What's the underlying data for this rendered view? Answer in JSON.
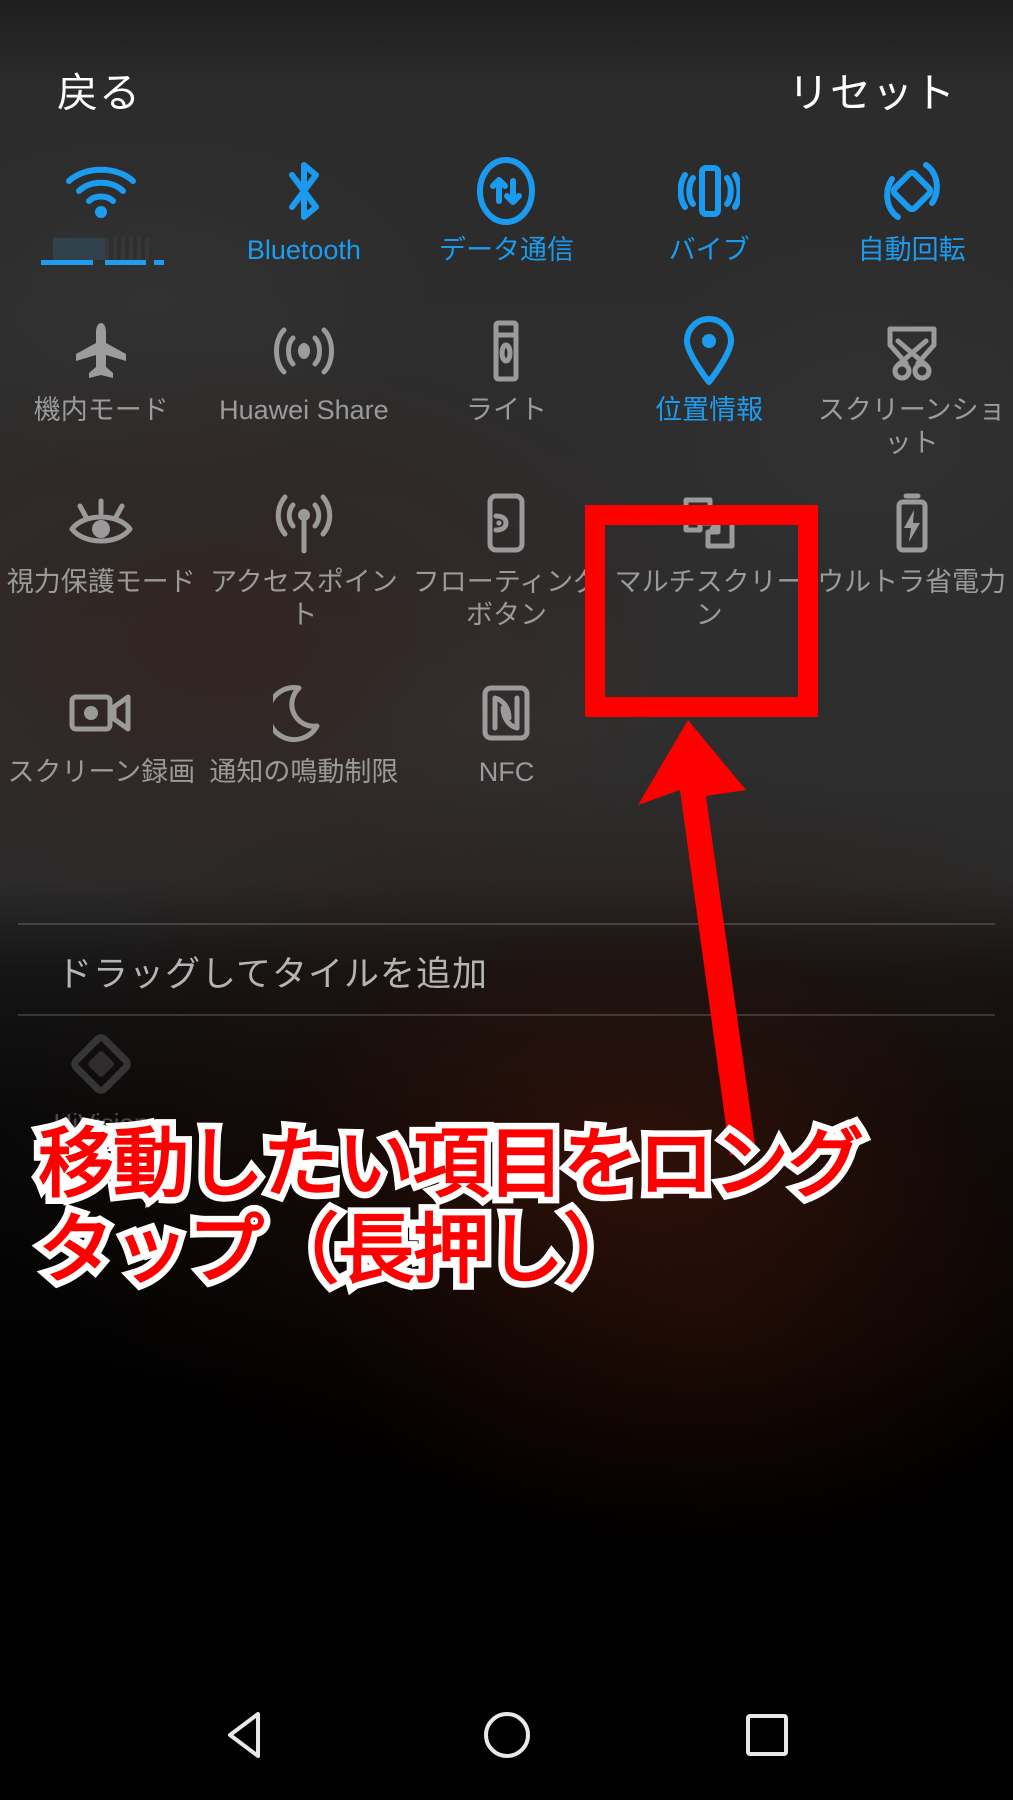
{
  "header": {
    "back_label": "戻る",
    "reset_label": "リセット"
  },
  "colors": {
    "active": "#1a9bf0",
    "inactive": "#9a9a9a",
    "annotation": "#ff0000",
    "annotation_outline": "#ffffff",
    "background": "#2e2e2e"
  },
  "tiles": {
    "rows": [
      [
        {
          "icon": "wifi-icon",
          "label": "",
          "label_redacted": true,
          "active": true
        },
        {
          "icon": "bluetooth-icon",
          "label": "Bluetooth",
          "active": true
        },
        {
          "icon": "data-transfer-icon",
          "label": "データ通信",
          "active": true
        },
        {
          "icon": "vibrate-icon",
          "label": "バイブ",
          "active": true
        },
        {
          "icon": "auto-rotate-icon",
          "label": "自動回転",
          "active": true
        }
      ],
      [
        {
          "icon": "airplane-icon",
          "label": "機内モード",
          "active": false
        },
        {
          "icon": "huawei-share-icon",
          "label": "Huawei Share",
          "active": false
        },
        {
          "icon": "flashlight-icon",
          "label": "ライト",
          "active": false
        },
        {
          "icon": "location-pin-icon",
          "label": "位置情報",
          "active": true
        },
        {
          "icon": "screenshot-icon",
          "label": "スクリーンショット",
          "active": false
        }
      ],
      [
        {
          "icon": "eye-protection-icon",
          "label": "視力保護モード",
          "active": false
        },
        {
          "icon": "hotspot-icon",
          "label": "アクセスポイント",
          "active": false
        },
        {
          "icon": "floating-button-icon",
          "label": "フローティングボタン",
          "active": false
        },
        {
          "icon": "multi-screen-icon",
          "label": "マルチスクリーン",
          "active": false,
          "highlighted": true
        },
        {
          "icon": "ultra-power-save-icon",
          "label": "ウルトラ省電力",
          "active": false
        }
      ],
      [
        {
          "icon": "screen-record-icon",
          "label": "スクリーン録画",
          "active": false
        },
        {
          "icon": "do-not-disturb-icon",
          "label": "通知の鳴動制限",
          "active": false
        },
        {
          "icon": "nfc-icon",
          "label": "NFC",
          "active": false
        },
        {
          "icon": "",
          "label": "",
          "active": false
        },
        {
          "icon": "",
          "label": "",
          "active": false
        }
      ]
    ]
  },
  "drag_hint": {
    "text": "ドラッグしてタイルを追加"
  },
  "available": {
    "icon": "diamond-icon",
    "label": "HiVision"
  },
  "annotation": {
    "line1": "移動したい項目をロング",
    "line2": "タップ（長押し）"
  },
  "navbar": {
    "back": "nav-back-triangle-icon",
    "home": "nav-home-circle-icon",
    "recent": "nav-recent-square-icon"
  }
}
